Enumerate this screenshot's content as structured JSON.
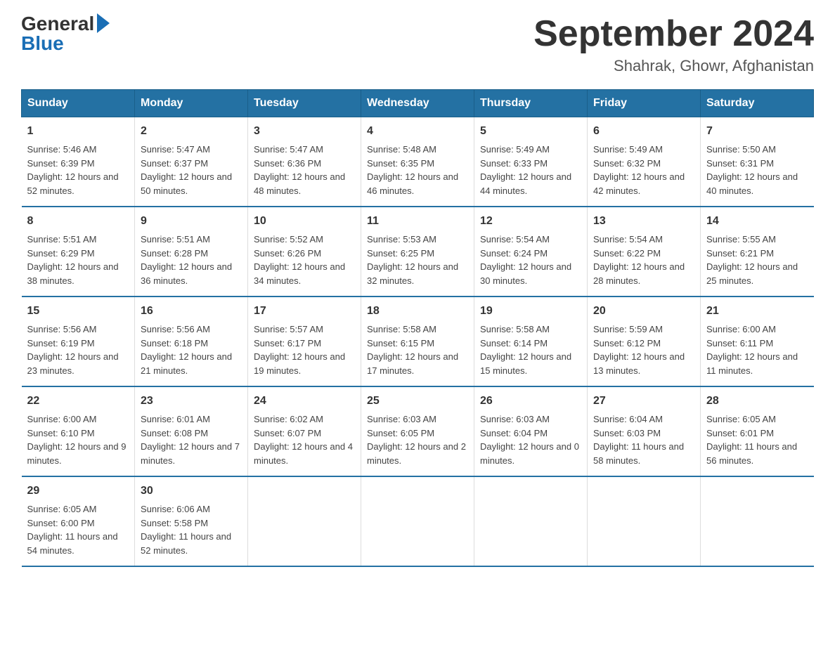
{
  "header": {
    "logo_general": "General",
    "logo_blue": "Blue",
    "title": "September 2024",
    "location": "Shahrak, Ghowr, Afghanistan"
  },
  "days_of_week": [
    "Sunday",
    "Monday",
    "Tuesday",
    "Wednesday",
    "Thursday",
    "Friday",
    "Saturday"
  ],
  "weeks": [
    [
      {
        "day": "1",
        "sunrise": "5:46 AM",
        "sunset": "6:39 PM",
        "daylight": "12 hours and 52 minutes."
      },
      {
        "day": "2",
        "sunrise": "5:47 AM",
        "sunset": "6:37 PM",
        "daylight": "12 hours and 50 minutes."
      },
      {
        "day": "3",
        "sunrise": "5:47 AM",
        "sunset": "6:36 PM",
        "daylight": "12 hours and 48 minutes."
      },
      {
        "day": "4",
        "sunrise": "5:48 AM",
        "sunset": "6:35 PM",
        "daylight": "12 hours and 46 minutes."
      },
      {
        "day": "5",
        "sunrise": "5:49 AM",
        "sunset": "6:33 PM",
        "daylight": "12 hours and 44 minutes."
      },
      {
        "day": "6",
        "sunrise": "5:49 AM",
        "sunset": "6:32 PM",
        "daylight": "12 hours and 42 minutes."
      },
      {
        "day": "7",
        "sunrise": "5:50 AM",
        "sunset": "6:31 PM",
        "daylight": "12 hours and 40 minutes."
      }
    ],
    [
      {
        "day": "8",
        "sunrise": "5:51 AM",
        "sunset": "6:29 PM",
        "daylight": "12 hours and 38 minutes."
      },
      {
        "day": "9",
        "sunrise": "5:51 AM",
        "sunset": "6:28 PM",
        "daylight": "12 hours and 36 minutes."
      },
      {
        "day": "10",
        "sunrise": "5:52 AM",
        "sunset": "6:26 PM",
        "daylight": "12 hours and 34 minutes."
      },
      {
        "day": "11",
        "sunrise": "5:53 AM",
        "sunset": "6:25 PM",
        "daylight": "12 hours and 32 minutes."
      },
      {
        "day": "12",
        "sunrise": "5:54 AM",
        "sunset": "6:24 PM",
        "daylight": "12 hours and 30 minutes."
      },
      {
        "day": "13",
        "sunrise": "5:54 AM",
        "sunset": "6:22 PM",
        "daylight": "12 hours and 28 minutes."
      },
      {
        "day": "14",
        "sunrise": "5:55 AM",
        "sunset": "6:21 PM",
        "daylight": "12 hours and 25 minutes."
      }
    ],
    [
      {
        "day": "15",
        "sunrise": "5:56 AM",
        "sunset": "6:19 PM",
        "daylight": "12 hours and 23 minutes."
      },
      {
        "day": "16",
        "sunrise": "5:56 AM",
        "sunset": "6:18 PM",
        "daylight": "12 hours and 21 minutes."
      },
      {
        "day": "17",
        "sunrise": "5:57 AM",
        "sunset": "6:17 PM",
        "daylight": "12 hours and 19 minutes."
      },
      {
        "day": "18",
        "sunrise": "5:58 AM",
        "sunset": "6:15 PM",
        "daylight": "12 hours and 17 minutes."
      },
      {
        "day": "19",
        "sunrise": "5:58 AM",
        "sunset": "6:14 PM",
        "daylight": "12 hours and 15 minutes."
      },
      {
        "day": "20",
        "sunrise": "5:59 AM",
        "sunset": "6:12 PM",
        "daylight": "12 hours and 13 minutes."
      },
      {
        "day": "21",
        "sunrise": "6:00 AM",
        "sunset": "6:11 PM",
        "daylight": "12 hours and 11 minutes."
      }
    ],
    [
      {
        "day": "22",
        "sunrise": "6:00 AM",
        "sunset": "6:10 PM",
        "daylight": "12 hours and 9 minutes."
      },
      {
        "day": "23",
        "sunrise": "6:01 AM",
        "sunset": "6:08 PM",
        "daylight": "12 hours and 7 minutes."
      },
      {
        "day": "24",
        "sunrise": "6:02 AM",
        "sunset": "6:07 PM",
        "daylight": "12 hours and 4 minutes."
      },
      {
        "day": "25",
        "sunrise": "6:03 AM",
        "sunset": "6:05 PM",
        "daylight": "12 hours and 2 minutes."
      },
      {
        "day": "26",
        "sunrise": "6:03 AM",
        "sunset": "6:04 PM",
        "daylight": "12 hours and 0 minutes."
      },
      {
        "day": "27",
        "sunrise": "6:04 AM",
        "sunset": "6:03 PM",
        "daylight": "11 hours and 58 minutes."
      },
      {
        "day": "28",
        "sunrise": "6:05 AM",
        "sunset": "6:01 PM",
        "daylight": "11 hours and 56 minutes."
      }
    ],
    [
      {
        "day": "29",
        "sunrise": "6:05 AM",
        "sunset": "6:00 PM",
        "daylight": "11 hours and 54 minutes."
      },
      {
        "day": "30",
        "sunrise": "6:06 AM",
        "sunset": "5:58 PM",
        "daylight": "11 hours and 52 minutes."
      },
      null,
      null,
      null,
      null,
      null
    ]
  ]
}
